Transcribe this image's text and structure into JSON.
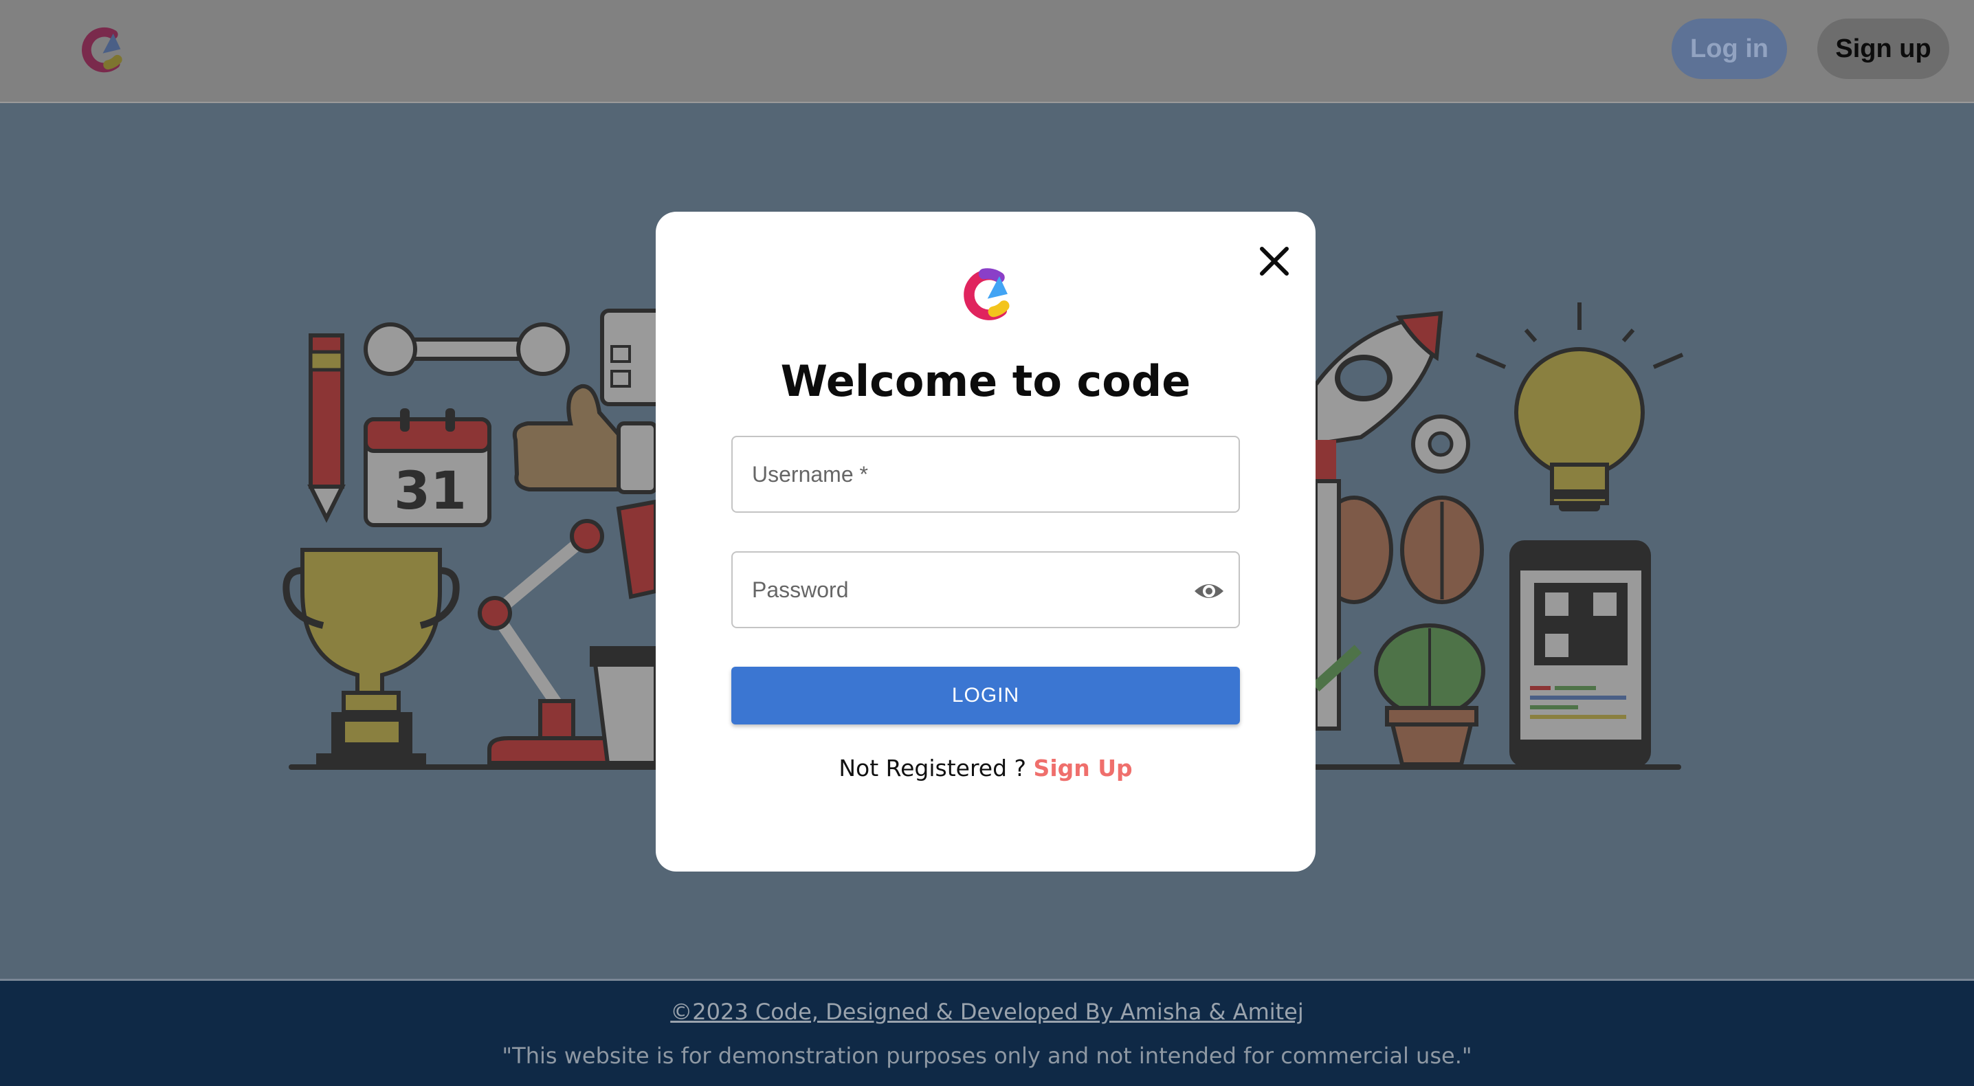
{
  "header": {
    "login_label": "Log in",
    "signup_label": "Sign up"
  },
  "modal": {
    "title": "Welcome to code",
    "username_placeholder": "Username *",
    "username_value": "",
    "password_placeholder": "Password",
    "password_value": "",
    "login_button_label": "LOGIN",
    "not_registered_text": "Not Registered ?",
    "signup_link_label": "Sign Up"
  },
  "illustration": {
    "calendar_day": "31"
  },
  "footer": {
    "credit": "©2023 Code, Designed & Developed By Amisha & Amitej",
    "note": "\"This website is for demonstration purposes only and not intended for commercial use.\""
  },
  "icons": {
    "logo": "code-logo-icon",
    "close": "close-icon",
    "password_toggle": "eye-icon"
  },
  "colors": {
    "login_button": "#3b76d2",
    "signup_link": "#ef6f6c",
    "footer_bg": "#0f2946",
    "overlay_bg": "#556675"
  }
}
